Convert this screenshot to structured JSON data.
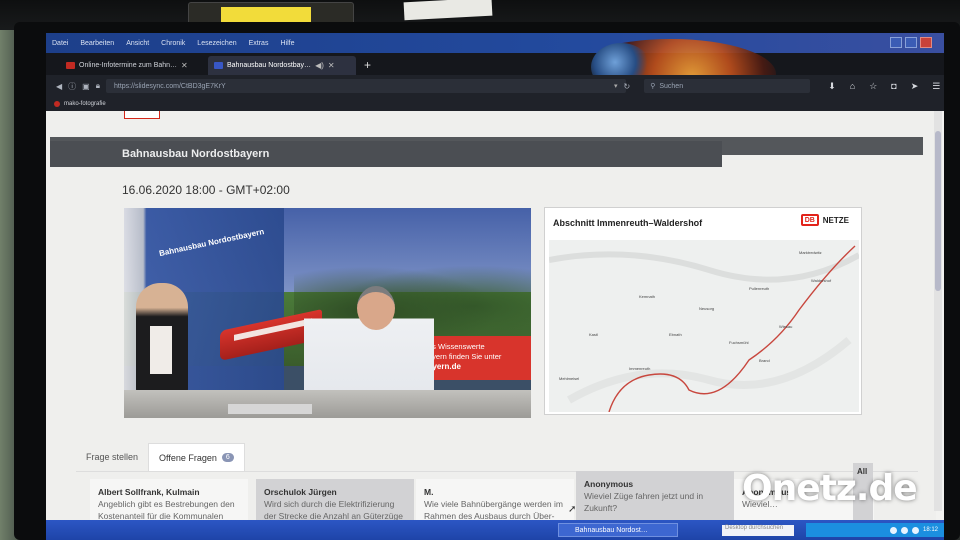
{
  "browser": {
    "menu": [
      "Datei",
      "Bearbeiten",
      "Ansicht",
      "Chronik",
      "Lesezeichen",
      "Extras",
      "Hilfe"
    ],
    "tabs": [
      {
        "label": "Online-Infotermine zum Bahn…",
        "active": false
      },
      {
        "label": "Bahnausbau Nordostbay…",
        "active": true
      }
    ],
    "url": "https://slidesync.com/CtBD3gE7KrY",
    "search_placeholder": "Suchen",
    "bookmark": "mako-fotografie"
  },
  "page": {
    "title": "Bahnausbau Nordostbayern",
    "datetime": "16.06.2020 18:00 - GMT+02:00",
    "video": {
      "wall_text": "Bahnausbau Nordostbayern",
      "banner_line1": "es Wissenswerte",
      "banner_line2": "ayern finden Sie unter",
      "banner_line3": "ayern.de"
    },
    "map": {
      "title": "Abschnitt Immenreuth–Waldershof",
      "logo_db": "DB",
      "logo_netze": "NETZE",
      "places": [
        "Marktredwitz",
        "Waldershof",
        "Kemnath",
        "Immenreuth",
        "Neusorg",
        "Pullenreuth",
        "Wiesau",
        "Fuchsmühl",
        "Ebnath",
        "Brand",
        "Kastl",
        "Mehlmeisel"
      ]
    },
    "questions": {
      "tab_ask": "Frage stellen",
      "tab_open": "Offene Fragen",
      "open_count": "6",
      "cards": [
        {
          "name": "Albert Sollfrank, Kulmain",
          "text": "Angeblich gibt es Bestrebungen den Kostenanteil für die Kommunalen Brücken über die"
        },
        {
          "name": "Orschulok Jürgen",
          "text": "Wird sich durch die Elektrifizierung der Strecke die Anzahl an Güterzüge erhöhen?"
        },
        {
          "name": "M.",
          "text": "Wie viele Bahnübergänge werden im Rahmen des Ausbaus durch Über- bzw."
        },
        {
          "name": "Anonymous",
          "text": "Wieviel Züge fahren jetzt und in Zukunft?"
        },
        {
          "name": "Anonymous",
          "text": "Wieviel…"
        }
      ],
      "all_label": "All"
    }
  },
  "taskbar": {
    "task_label": "Bahnausbau Nordost…",
    "search_placeholder": "Desktop durchsuchen",
    "clock": "18:12"
  },
  "watermark": "Onetz.de",
  "colors": {
    "accent_red": "#d8342c",
    "titlebar": "#4b4e53",
    "taskbar": "#1e44a8"
  }
}
